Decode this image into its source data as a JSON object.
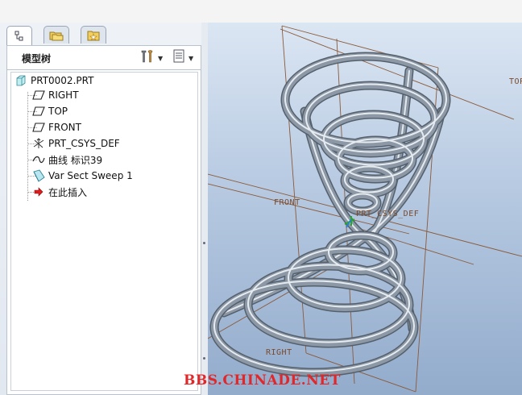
{
  "panel": {
    "tabs": [
      {
        "icon": "model-tree-tab-icon",
        "active": true
      },
      {
        "icon": "folder-browser-tab-icon",
        "active": false
      },
      {
        "icon": "favorites-tab-icon",
        "active": false
      }
    ],
    "title": "模型树",
    "tools_icon": "tree-tools-icon",
    "settings_icon": "tree-settings-icon"
  },
  "tree": {
    "root": {
      "label": "PRT0002.PRT",
      "icon": "part-icon"
    },
    "items": [
      {
        "label": "RIGHT",
        "icon": "datum-plane-icon"
      },
      {
        "label": "TOP",
        "icon": "datum-plane-icon"
      },
      {
        "label": "FRONT",
        "icon": "datum-plane-icon"
      },
      {
        "label": "PRT_CSYS_DEF",
        "icon": "coordinate-system-icon"
      },
      {
        "label": "曲线 标识39",
        "icon": "curve-icon"
      },
      {
        "label": "Var Sect Sweep 1",
        "icon": "var-sect-sweep-icon"
      },
      {
        "label": "在此插入",
        "icon": "insert-here-arrow-icon"
      }
    ]
  },
  "viewport": {
    "datum_labels": {
      "front": "FRONT",
      "top": "TOP",
      "right": "RIGHT",
      "csys": "PRT_CSYS_DEF"
    },
    "colors": {
      "datum": "#8a5a3a",
      "tube": "#8c98a6"
    }
  },
  "watermark": "BBS.CHINADE.NET"
}
